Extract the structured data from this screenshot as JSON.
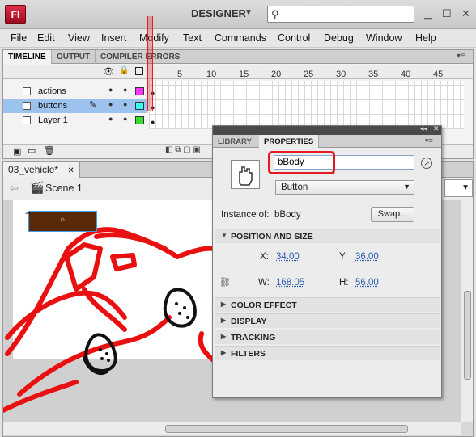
{
  "app": {
    "logo": "Fl",
    "workspace": "DESIGNER"
  },
  "icons": {
    "search": "search-icon",
    "minimize": "minimize-icon",
    "maximize": "maximize-icon",
    "close": "close-icon",
    "link": "link-icon",
    "hand": "hand-cursor-icon"
  },
  "menu": [
    "File",
    "Edit",
    "View",
    "Insert",
    "Modify",
    "Text",
    "Commands",
    "Control",
    "Debug",
    "Window",
    "Help"
  ],
  "timeline": {
    "tabs": [
      "TIMELINE",
      "OUTPUT",
      "COMPILER ERRORS"
    ],
    "frame_numbers": [
      "5",
      "10",
      "15",
      "20",
      "25",
      "30",
      "35",
      "40",
      "45"
    ],
    "layers": [
      {
        "name": "actions",
        "color": "#ff33ff",
        "selected": false
      },
      {
        "name": "buttons",
        "color": "#33ffff",
        "selected": true
      },
      {
        "name": "Layer 1",
        "color": "#33dd33",
        "selected": false
      }
    ]
  },
  "document": {
    "tab": "03_vehicle*",
    "scene": "Scene 1"
  },
  "properties": {
    "tabs": [
      "LIBRARY",
      "PROPERTIES"
    ],
    "instance_name": "bBody",
    "type": "Button",
    "instance_of_label": "Instance of:",
    "instance_of": "bBody",
    "swap": "Swap...",
    "position_section": "POSITION AND SIZE",
    "x_label": "X:",
    "x": "34.00",
    "y_label": "Y:",
    "y": "36.00",
    "w_label": "W:",
    "w": "168.05",
    "h_label": "H:",
    "h": "56.00",
    "sections": [
      "COLOR EFFECT",
      "DISPLAY",
      "TRACKING",
      "FILTERS"
    ]
  }
}
